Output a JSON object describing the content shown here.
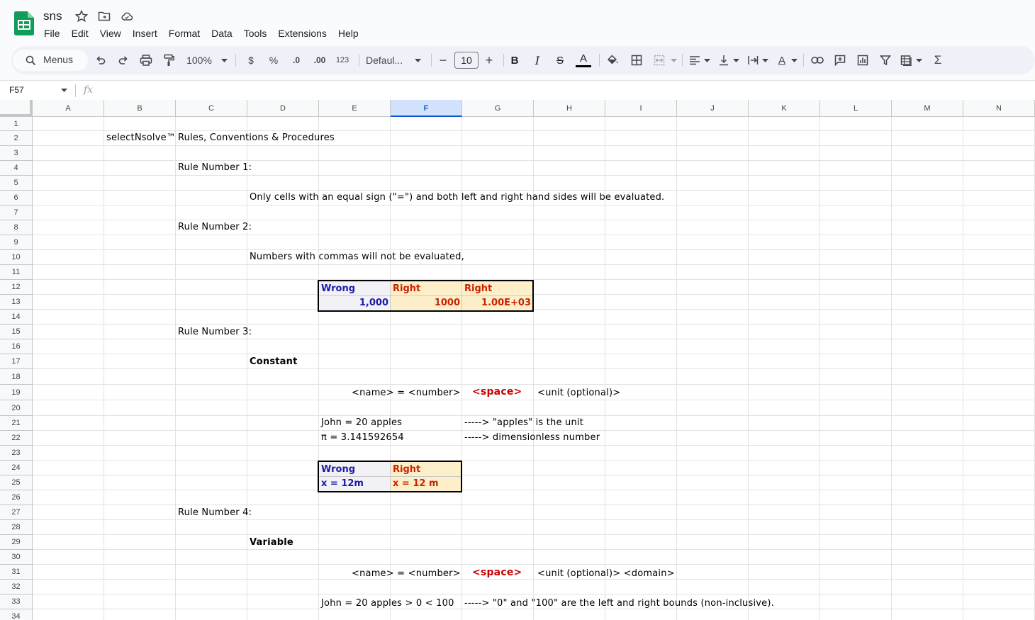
{
  "app": {
    "doc_title": "sns",
    "menus": [
      "File",
      "Edit",
      "View",
      "Insert",
      "Format",
      "Data",
      "Tools",
      "Extensions",
      "Help"
    ]
  },
  "toolbar": {
    "search_label": "Menus",
    "zoom": "100%",
    "currency": "$",
    "percent": "%",
    "dec_decrease": ".0",
    "dec_increase": ".00",
    "number_format": "123",
    "font_family": "Defaul...",
    "font_size": "10",
    "font_minus": "−",
    "font_plus": "+",
    "bold": "B",
    "italic": "I",
    "strike": "S",
    "text_color": "A",
    "text_rotation": "A",
    "functions": "Σ"
  },
  "formula_bar": {
    "cell_ref": "F57",
    "fx": "fx"
  },
  "grid": {
    "columns": [
      "A",
      "B",
      "C",
      "D",
      "E",
      "F",
      "G",
      "H",
      "I",
      "J",
      "K",
      "L",
      "M",
      "N"
    ],
    "selected_column": "F",
    "rows": [
      "1",
      "2",
      "3",
      "4",
      "5",
      "6",
      "7",
      "8",
      "9",
      "10",
      "11",
      "12",
      "13",
      "14",
      "15",
      "16",
      "17",
      "18",
      "19",
      "20",
      "21",
      "22",
      "23",
      "24",
      "25",
      "26",
      "27",
      "28",
      "29",
      "30",
      "31",
      "32",
      "33",
      "34"
    ]
  },
  "content": {
    "b2": "selectNsolve™",
    "c2": "Rules, Conventions & Procedures",
    "c4": "Rule Number 1:",
    "d6": "Only cells with an equal sign (\"=\") and both left and right hand sides will be evaluated.",
    "c8": "Rule Number 2:",
    "d10": "Numbers with commas will not be evaluated,",
    "t1_e12": "Wrong",
    "t1_f12": "Right",
    "t1_g12": "Right",
    "t1_e13": "1,000",
    "t1_f13": "1000",
    "t1_g13": "1.00E+03",
    "c15": "Rule Number 3:",
    "d17": "Constant",
    "e19": "<name> = <number>",
    "f19": "<space>",
    "g19": "<unit (optional)>",
    "e21": "John = 20 apples",
    "g21": "-----> \"apples\" is the unit",
    "e22": "π = 3.141592654",
    "g22": "-----> dimensionless number",
    "t2_e24": "Wrong",
    "t2_f24": "Right",
    "t2_e25": "x = 12m",
    "t2_f25": "x = 12 m",
    "c27": "Rule Number 4:",
    "d29": "Variable",
    "e31": "<name> = <number>",
    "f31": "<space>",
    "g31": "<unit (optional)> <domain>",
    "e33": "John = 20 apples > 0 < 100",
    "g33": "-----> \"0\" and \"100\" are the left and right bounds (non-inclusive)."
  },
  "colors": {
    "wrong_text": "#1a1aa6",
    "right_text": "#cc2200",
    "right_fill": "#fdefc9",
    "selection": "#d3e3fd"
  }
}
